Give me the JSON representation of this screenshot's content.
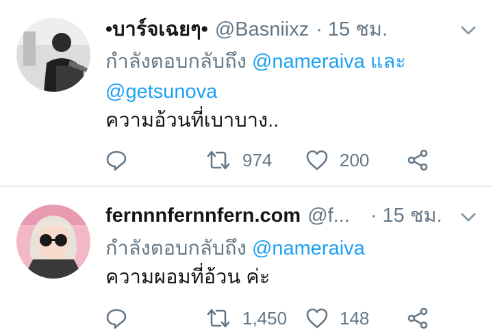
{
  "tweets": [
    {
      "name": "•บาร์จเฉยๆ•",
      "handle": "@Basniixz",
      "time": "15 ชม.",
      "reply_prefix": "กำลังตอบกลับถึง",
      "mention_1": "@nameraiva",
      "reply_joiner": "และ",
      "mention_2": "@getsunova",
      "text": "ความอ้วนที่เบาบาง..",
      "retweets": "974",
      "likes": "200"
    },
    {
      "name": "fernnnfernnfern.com",
      "handle": "@f...",
      "time": "15 ชม.",
      "reply_prefix": "กำลังตอบกลับถึง",
      "mention_1": "@nameraiva",
      "text": "ความผอมที่อ้วน ค่ะ",
      "retweets": "1,450",
      "likes": "148"
    }
  ],
  "icons": {
    "reply": "reply-icon",
    "retweet": "retweet-icon",
    "like": "heart-icon",
    "share": "share-icon",
    "menu": "chevron-down-icon"
  },
  "colors": {
    "text": "#14171a",
    "secondary": "#657786",
    "link": "#1da1f2",
    "divider": "#e6ecf0"
  }
}
